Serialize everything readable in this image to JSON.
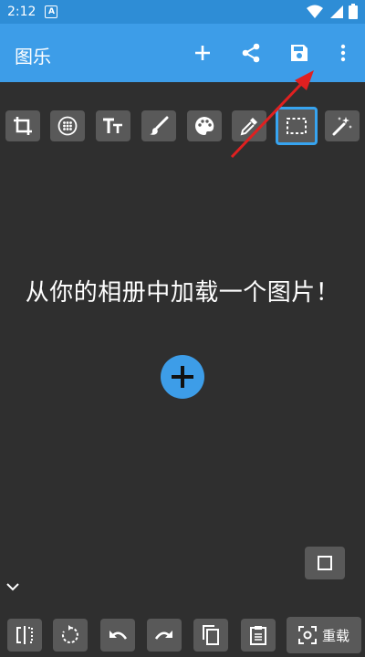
{
  "status_bar": {
    "time": "2:12",
    "notification_letter": "A"
  },
  "app_bar": {
    "title": "图乐",
    "actions": [
      "add-icon",
      "share-icon",
      "save-icon",
      "more-vert-icon"
    ]
  },
  "toolbar": {
    "tools": [
      "crop-icon",
      "grid-dots-icon",
      "text-icon",
      "brush-icon",
      "palette-icon",
      "eyedropper-icon",
      "select-rect-icon",
      "magic-wand-icon"
    ],
    "selected_tool": "select-rect-icon"
  },
  "canvas": {
    "message": "从你的相册中加载一个图片！"
  },
  "bottom_bar": {
    "buttons": [
      "mirror-icon",
      "rotate-icon",
      "undo-icon",
      "redo-icon",
      "copy-icon",
      "paste-icon"
    ],
    "reset_label": "重载"
  },
  "colors": {
    "status_bar": "#2e8dd6",
    "app_bar": "#3d9de8",
    "background": "#2f2f2f",
    "button": "#595959",
    "selected_outline": "#37a4f0",
    "annotation_arrow": "#e02020"
  }
}
